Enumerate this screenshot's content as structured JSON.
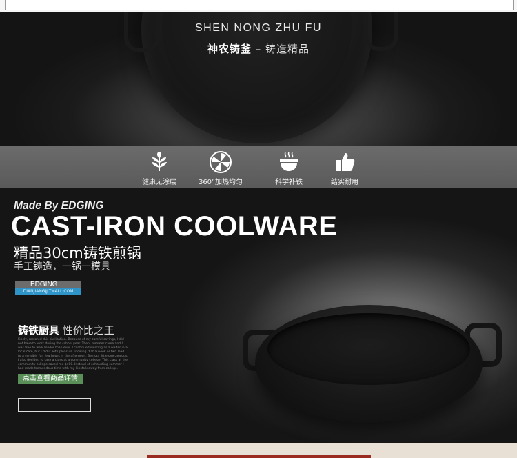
{
  "hero": {
    "brand_en": "SHEN NONG ZHU FU",
    "brand_cn_bold": "神农铸釜",
    "brand_cn_rest": " – 铸造精品"
  },
  "features": [
    {
      "label": "健康无涂层",
      "icon": "leaf-icon"
    },
    {
      "label": "360°加热均匀",
      "icon": "heat-fan-icon"
    },
    {
      "label": "科学补铁",
      "icon": "steaming-bowl-icon"
    },
    {
      "label": "结实耐用",
      "icon": "thumbs-up-icon"
    }
  ],
  "product": {
    "made_by": "Made By EDGING",
    "title": "CAST-IRON COOLWARE",
    "subtitle": "精品30cm铸铁煎锅",
    "subtitle2": "手工铸造，一锅一模具",
    "brand_name": "EDGING",
    "brand_url": "DIANJIANGJJ.TMALL.COM",
    "kitchen_bold": "铸铁厨具",
    "kitchen_rest": " 性价比之王",
    "description": "Finely, restored this civilization. Because of my careful savings, I did not have to work during the school year. Then, summer came and I was free to walk fonder than ever. I continued working as a waiter in a local cafe, but I did it with pleasure knowing that a week or two lead to a sensibly fun few hours in the afternoon. Being a little overzealous, I also decided to take a class at a community college. This class at the community college saved me $400. Instead of exhausting summer I had made tremendous time with my kinsfolk away from college.",
    "detail_button": "点击查看商品详情"
  },
  "colors": {
    "accent_green": "#5a8f5a",
    "accent_blue": "#2f95c8",
    "accent_red": "#9a2b20"
  }
}
